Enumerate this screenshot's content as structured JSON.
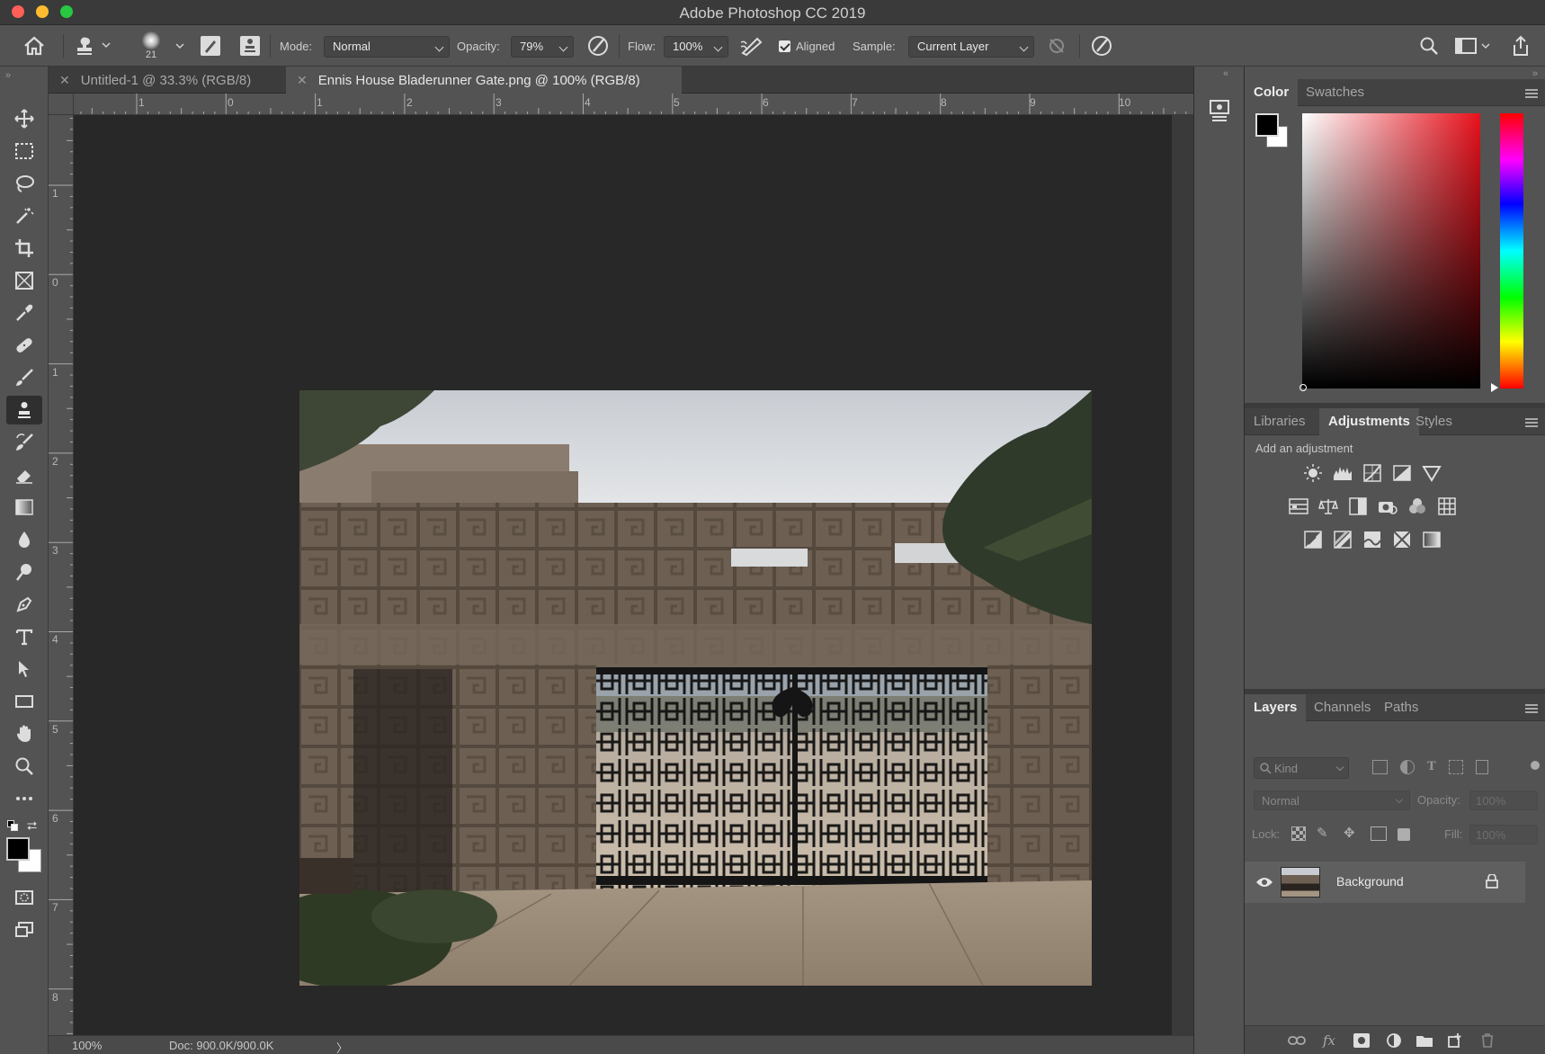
{
  "window": {
    "title": "Adobe Photoshop CC 2019"
  },
  "options_bar": {
    "brush_size": "21",
    "mode_label": "Mode:",
    "mode_value": "Normal",
    "opacity_label": "Opacity:",
    "opacity_value": "79%",
    "flow_label": "Flow:",
    "flow_value": "100%",
    "aligned_label": "Aligned",
    "aligned_checked": true,
    "sample_label": "Sample:",
    "sample_value": "Current Layer"
  },
  "document_tabs": [
    {
      "label": "Untitled-1 @ 33.3% (RGB/8)",
      "active": false
    },
    {
      "label": "Ennis House Bladerunner Gate.png @ 100% (RGB/8)",
      "active": true
    }
  ],
  "rulers": {
    "top": [
      "1",
      "0",
      "1",
      "2",
      "3",
      "4",
      "5",
      "6",
      "7",
      "8",
      "9",
      "10"
    ],
    "left": [
      "1",
      "0",
      "1",
      "2",
      "3",
      "4",
      "5",
      "6",
      "7",
      "8"
    ]
  },
  "status": {
    "zoom": "100%",
    "doc": "Doc: 900.0K/900.0K",
    "arrow": "〉"
  },
  "color_panel": {
    "tabs": [
      "Color",
      "Swatches"
    ],
    "foreground": "#000000",
    "background": "#ffffff",
    "hue": "#ff0000"
  },
  "adjustments_panel": {
    "tabs": [
      "Libraries",
      "Adjustments",
      "Styles"
    ],
    "hint": "Add an adjustment",
    "icons": [
      [
        "brightness-contrast-icon",
        "levels-icon",
        "curves-icon",
        "exposure-icon",
        "vibrance-icon"
      ],
      [
        "hue-saturation-icon",
        "color-balance-icon",
        "black-white-icon",
        "photo-filter-icon",
        "channel-mixer-icon",
        "color-lookup-icon"
      ],
      [
        "invert-icon",
        "posterize-icon",
        "threshold-icon",
        "selective-color-icon",
        "gradient-map-icon"
      ]
    ]
  },
  "layers_panel": {
    "tabs": [
      "Layers",
      "Channels",
      "Paths"
    ],
    "kind_placeholder": "Kind",
    "blend_mode": "Normal",
    "opacity_label": "Opacity:",
    "opacity_value": "100%",
    "lock_label": "Lock:",
    "fill_label": "Fill:",
    "fill_value": "100%",
    "layers": [
      {
        "name": "Background",
        "visible": true,
        "locked": true
      }
    ]
  },
  "toolbar": {
    "tools": [
      "move-tool",
      "marquee-tool",
      "lasso-tool",
      "magic-wand-tool",
      "crop-tool",
      "frame-tool",
      "eyedropper-tool",
      "healing-brush-tool",
      "brush-tool",
      "clone-stamp-tool",
      "history-brush-tool",
      "eraser-tool",
      "gradient-tool",
      "blur-tool",
      "dodge-tool",
      "pen-tool",
      "type-tool",
      "path-selection-tool",
      "rectangle-tool",
      "hand-tool",
      "zoom-tool",
      "more-tools"
    ],
    "active": "clone-stamp-tool"
  }
}
